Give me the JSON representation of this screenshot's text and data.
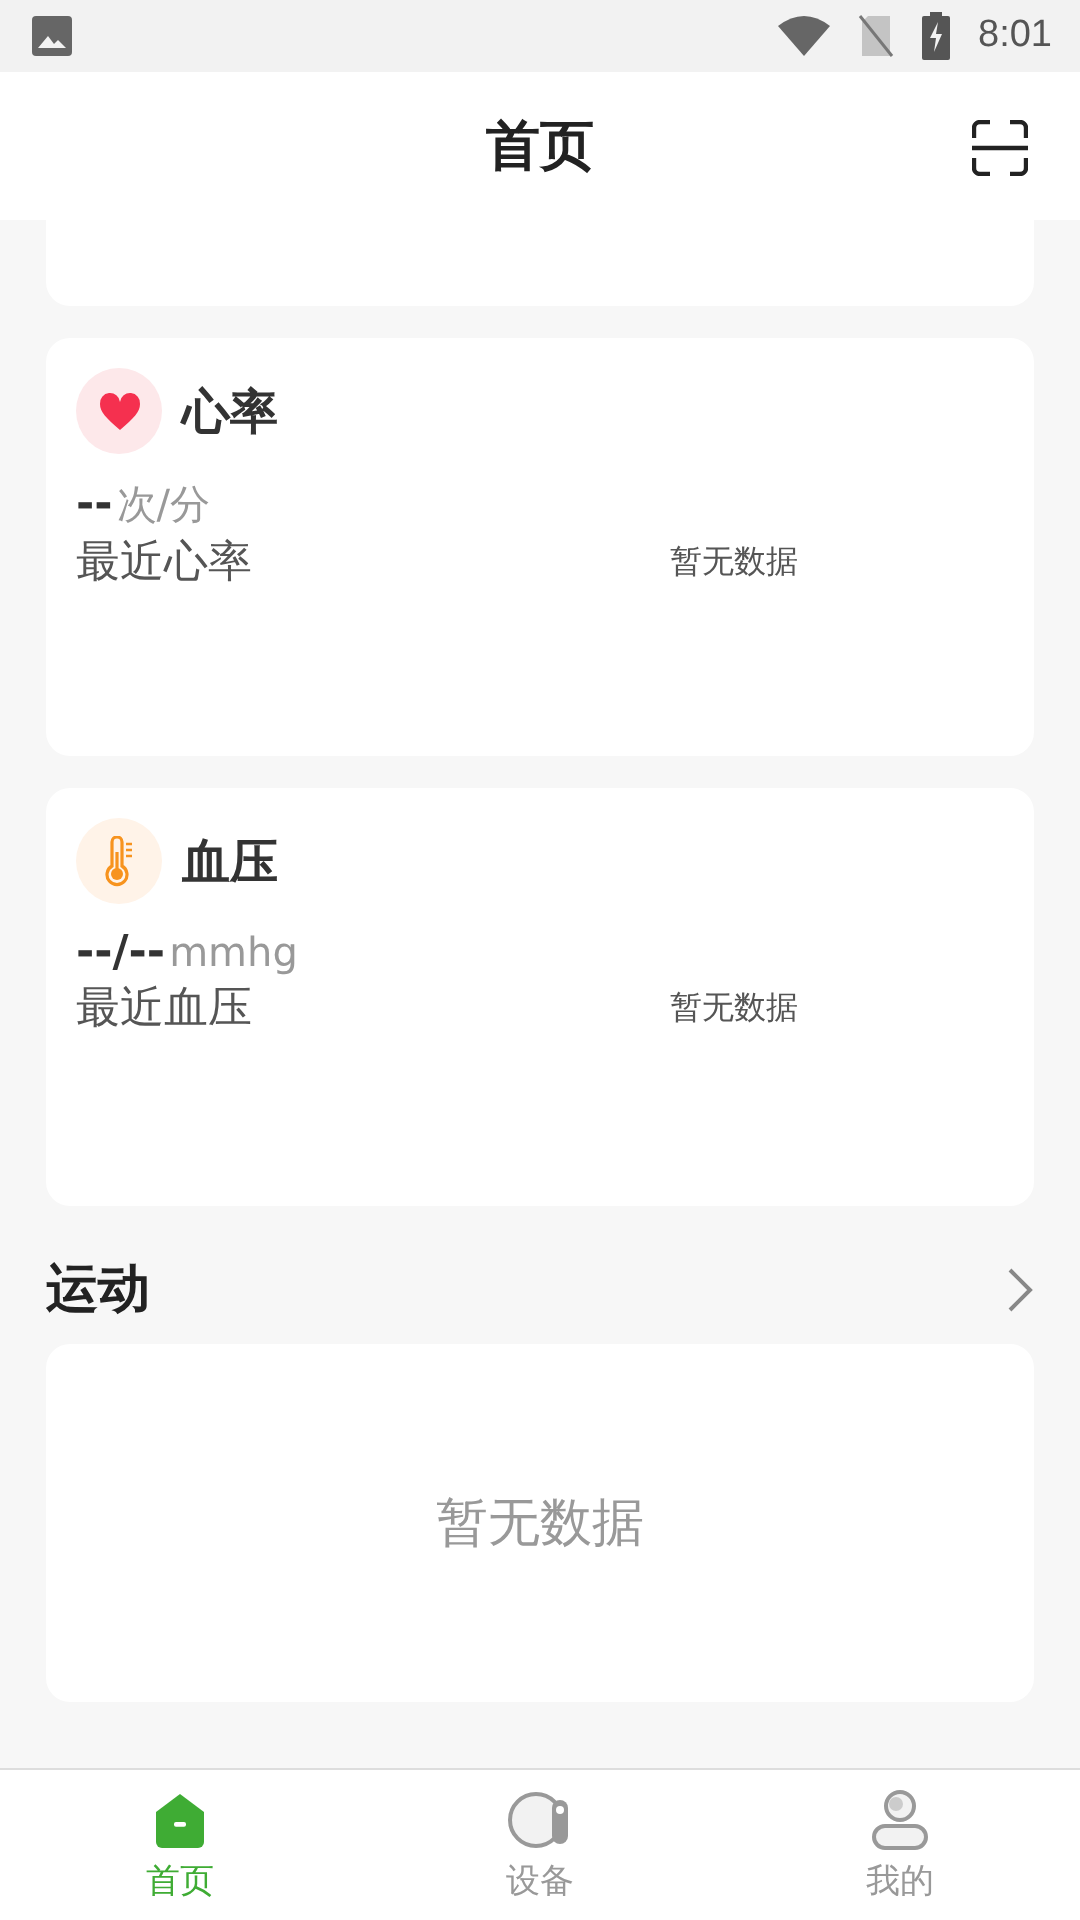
{
  "status_bar": {
    "time": "8:01"
  },
  "header": {
    "title": "首页"
  },
  "metrics": [
    {
      "kind": "heart",
      "title": "心率",
      "value": "--",
      "unit": "次/分",
      "label": "最近心率",
      "status": "暂无数据"
    },
    {
      "kind": "thermometer",
      "title": "血压",
      "value": "--/--",
      "unit": "mmhg",
      "label": "最近血压",
      "status": "暂无数据"
    }
  ],
  "sport": {
    "title": "运动",
    "empty": "暂无数据"
  },
  "tabs": [
    {
      "kind": "home",
      "label": "首页",
      "selected": true
    },
    {
      "kind": "device",
      "label": "设备",
      "selected": false
    },
    {
      "kind": "profile",
      "label": "我的",
      "selected": false
    }
  ]
}
